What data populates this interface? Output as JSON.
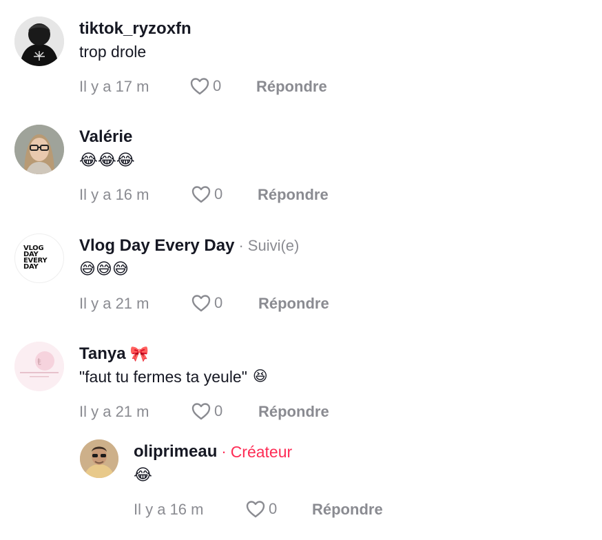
{
  "colors": {
    "text_primary": "#161823",
    "text_secondary": "#8a8b91",
    "creator_accent": "#fe2c55"
  },
  "comments": [
    {
      "username": "tiktok_ryzoxfn",
      "text": "trop drole",
      "time": "Il y a 17 m",
      "likes": "0",
      "reply_label": "Répondre",
      "avatar": "dark-photo-avatar"
    },
    {
      "username": "Valérie",
      "text": "😂😂😂",
      "time": "Il y a 16 m",
      "likes": "0",
      "reply_label": "Répondre",
      "avatar": "woman-glasses-avatar"
    },
    {
      "username": "Vlog Day Every Day",
      "separator": "·",
      "badge": "Suivi(e)",
      "text": "😅😅😅",
      "time": "Il y a 21 m",
      "likes": "0",
      "reply_label": "Répondre",
      "avatar": "vlog-logo-avatar",
      "avatar_text": "VLOG DAY EVERY DAY"
    },
    {
      "username": "Tanya",
      "username_emoji": "🎀",
      "text": "\"faut tu fermes ta yeule\"",
      "text_emoji": "😆",
      "time": "Il y a 21 m",
      "likes": "0",
      "reply_label": "Répondre",
      "avatar": "pink-logo-avatar"
    }
  ],
  "reply": {
    "username": "oliprimeau",
    "separator": "·",
    "badge": "Créateur",
    "text": "😂",
    "time": "Il y a 16 m",
    "likes": "0",
    "reply_label": "Répondre",
    "avatar": "man-sunglasses-avatar"
  }
}
